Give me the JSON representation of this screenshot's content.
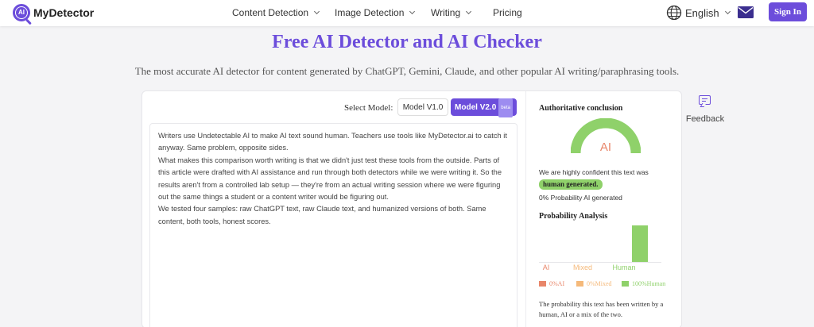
{
  "nav": {
    "logo_badge": "AI",
    "logo_text": "MyDetector",
    "items": [
      {
        "label": "Content Detection",
        "dropdown": true
      },
      {
        "label": "Image Detection",
        "dropdown": true
      },
      {
        "label": "Writing",
        "dropdown": true
      },
      {
        "label": "Pricing",
        "dropdown": false
      }
    ],
    "language": "English",
    "sign_in_label": "Sign In",
    "icons": [
      "globe-icon",
      "mail-icon"
    ]
  },
  "hero": {
    "title": "Free AI Detector and AI Checker",
    "subtitle": "The most accurate AI detector for content generated by ChatGPT, Gemini, Claude, and other popular AI writing/paraphrasing tools."
  },
  "model_select": {
    "label": "Select Model:",
    "options": [
      "Model V1.0",
      "Model V2.0"
    ],
    "selected": "Model V2.0",
    "beta_badge": "beta"
  },
  "input_text": [
    "Writers use Undetectable AI to make AI text sound human. Teachers use tools like MyDetector.ai to catch it anyway. Same problem, opposite sides.",
    "What makes this comparison worth writing is that we didn't just test these tools from the outside. Parts of this article were drafted with AI assistance and run through both detectors while we were writing it. So the results aren't from a controlled lab setup — they're from an actual writing session where we were figuring out the same things a student or a content writer would be figuring out.",
    "We tested four samples: raw ChatGPT text, raw Claude text, and humanized versions of both. Same content, both tools, honest scores."
  ],
  "result": {
    "conclusion_heading": "Authoritative conclusion",
    "gauge_label": "AI",
    "confidence_text": "We are highly confident this text was",
    "verdict": "human generated.",
    "probability_text": "0% Probability AI generated",
    "analysis_heading": "Probability Analysis",
    "description": "The probability this text has been written by a human, AI or a mix of the two."
  },
  "chart_data": {
    "type": "bar",
    "categories": [
      "AI",
      "Mixed",
      "Human"
    ],
    "values": [
      0,
      0,
      100
    ],
    "ylim": [
      0,
      100
    ],
    "legend": [
      "0%AI",
      "0%Mixed",
      "100%Human"
    ],
    "colors": {
      "AI": "#e8866a",
      "Mixed": "#f5b97a",
      "Human": "#8fd16a"
    }
  },
  "feedback": {
    "label": "Feedback"
  },
  "colors": {
    "brand": "#6c4ddb",
    "human": "#8fd16a",
    "ai": "#e8866a",
    "mixed": "#f5b97a"
  }
}
